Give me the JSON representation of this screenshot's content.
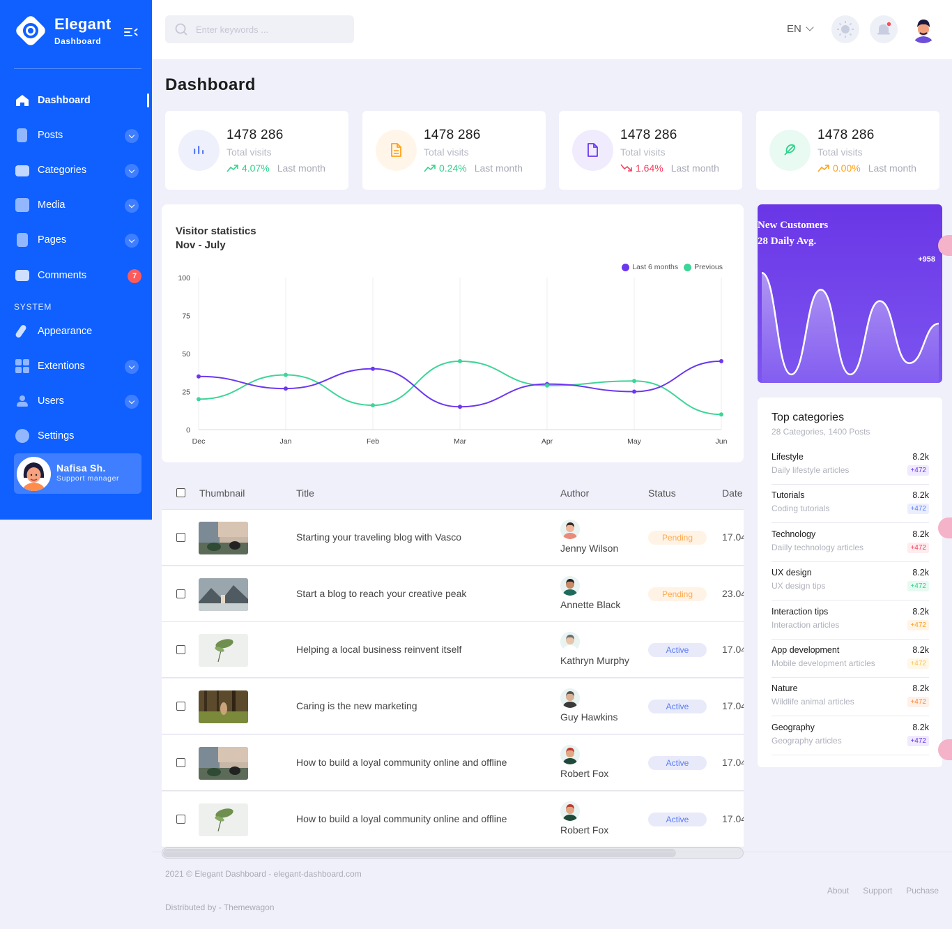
{
  "brand": {
    "title": "Elegant",
    "subtitle": "Dashboard"
  },
  "sidebar": {
    "items": [
      {
        "label": "Dashboard"
      },
      {
        "label": "Posts"
      },
      {
        "label": "Categories"
      },
      {
        "label": "Media"
      },
      {
        "label": "Pages"
      },
      {
        "label": "Comments",
        "badge": "7"
      }
    ],
    "system_label": "SYSTEM",
    "system_items": [
      {
        "label": "Appearance"
      },
      {
        "label": "Extentions"
      },
      {
        "label": "Users"
      },
      {
        "label": "Settings"
      }
    ],
    "profile": {
      "name": "Nafisa Sh.",
      "role": "Support manager"
    }
  },
  "header": {
    "search_placeholder": "Enter keywords ...",
    "language": "EN"
  },
  "page_title": "Dashboard",
  "stats": [
    {
      "value": "1478 286",
      "label": "Total visits",
      "change": "4.07%",
      "period": "Last month",
      "trend": "up",
      "color": "#2fd38b"
    },
    {
      "value": "1478 286",
      "label": "Total visits",
      "change": "0.24%",
      "period": "Last month",
      "trend": "up",
      "color": "#2fd38b"
    },
    {
      "value": "1478 286",
      "label": "Total visits",
      "change": "1.64%",
      "period": "Last month",
      "trend": "down",
      "color": "#f5405f"
    },
    {
      "value": "1478 286",
      "label": "Total visits",
      "change": "0.00%",
      "period": "Last month",
      "trend": "up",
      "color": "#ffa11a"
    }
  ],
  "chart_data": [
    {
      "type": "line",
      "title": "Visitor statistics",
      "subtitle": "Nov - July",
      "categories": [
        "Dec",
        "Jan",
        "Feb",
        "Mar",
        "Apr",
        "May",
        "Jun"
      ],
      "ylim": [
        0,
        100
      ],
      "yticks": [
        0,
        25,
        50,
        75,
        100
      ],
      "grid": "vertical",
      "legend_position": "top-right",
      "series": [
        {
          "name": "Last 6 months",
          "color": "#6b37f0",
          "values": [
            35,
            27,
            40,
            15,
            30,
            25,
            45
          ]
        },
        {
          "name": "Previous",
          "color": "#3dd598",
          "values": [
            20,
            36,
            16,
            45,
            29,
            32,
            10
          ]
        }
      ]
    },
    {
      "type": "area",
      "title": "New Customers",
      "subtitle": "28 Daily Avg.",
      "annotation": "+958",
      "values": [
        95,
        5,
        80,
        5,
        70,
        15,
        50
      ]
    }
  ],
  "top_categories": {
    "title": "Top categories",
    "subtitle": "28 Categories, 1400 Posts",
    "items": [
      {
        "name": "Lifestyle",
        "desc": "Daily lifestyle articles",
        "count": "8.2k",
        "delta": "+472",
        "color": "#6b37f0",
        "bg": "#efeafe"
      },
      {
        "name": "Tutorials",
        "desc": "Coding tutorials",
        "count": "8.2k",
        "delta": "+472",
        "color": "#5b7cf5",
        "bg": "#eaeefe"
      },
      {
        "name": "Technology",
        "desc": "Dailly technology articles",
        "count": "8.2k",
        "delta": "+472",
        "color": "#f5405f",
        "bg": "#feecef"
      },
      {
        "name": "UX design",
        "desc": "UX design tips",
        "count": "8.2k",
        "delta": "+472",
        "color": "#2fd38b",
        "bg": "#e7faf1"
      },
      {
        "name": "Interaction tips",
        "desc": "Interaction articles",
        "count": "8.2k",
        "delta": "+472",
        "color": "#ffa11a",
        "bg": "#fff4e5"
      },
      {
        "name": "App development",
        "desc": "Mobile development articles",
        "count": "8.2k",
        "delta": "+472",
        "color": "#ffc24a",
        "bg": "#fff8e8"
      },
      {
        "name": "Nature",
        "desc": "Wildlife animal articles",
        "count": "8.2k",
        "delta": "+472",
        "color": "#ff8a3d",
        "bg": "#fff1e8"
      },
      {
        "name": "Geography",
        "desc": "Geography articles",
        "count": "8.2k",
        "delta": "+472",
        "color": "#6b37f0",
        "bg": "#efeafe"
      }
    ]
  },
  "table": {
    "headers": [
      "Thumbnail",
      "Title",
      "Author",
      "Status",
      "Date"
    ],
    "rows": [
      {
        "title": "Starting your traveling blog with Vasco",
        "author": "Jenny Wilson",
        "status": "Pending",
        "date": "17.04",
        "thumb": "room"
      },
      {
        "title": "Start a blog to reach your creative peak",
        "author": "Annette Black",
        "status": "Pending",
        "date": "23.04",
        "thumb": "mountain"
      },
      {
        "title": "Helping a local business reinvent itself",
        "author": "Kathryn Murphy",
        "status": "Active",
        "date": "17.04",
        "thumb": "plant"
      },
      {
        "title": "Caring is the new marketing",
        "author": "Guy Hawkins",
        "status": "Active",
        "date": "17.04",
        "thumb": "forest"
      },
      {
        "title": "How to build a loyal community online and offline",
        "author": "Robert Fox",
        "status": "Active",
        "date": "17.04",
        "thumb": "room"
      },
      {
        "title": "How to build a loyal community online and offline",
        "author": "Robert Fox",
        "status": "Active",
        "date": "17.04",
        "thumb": "plant"
      }
    ]
  },
  "footer": {
    "copyright": "2021 © Elegant Dashboard - elegant-dashboard.com",
    "distributed": "Distributed by - Themewagon",
    "links": [
      "About",
      "Support",
      "Puchase"
    ]
  }
}
